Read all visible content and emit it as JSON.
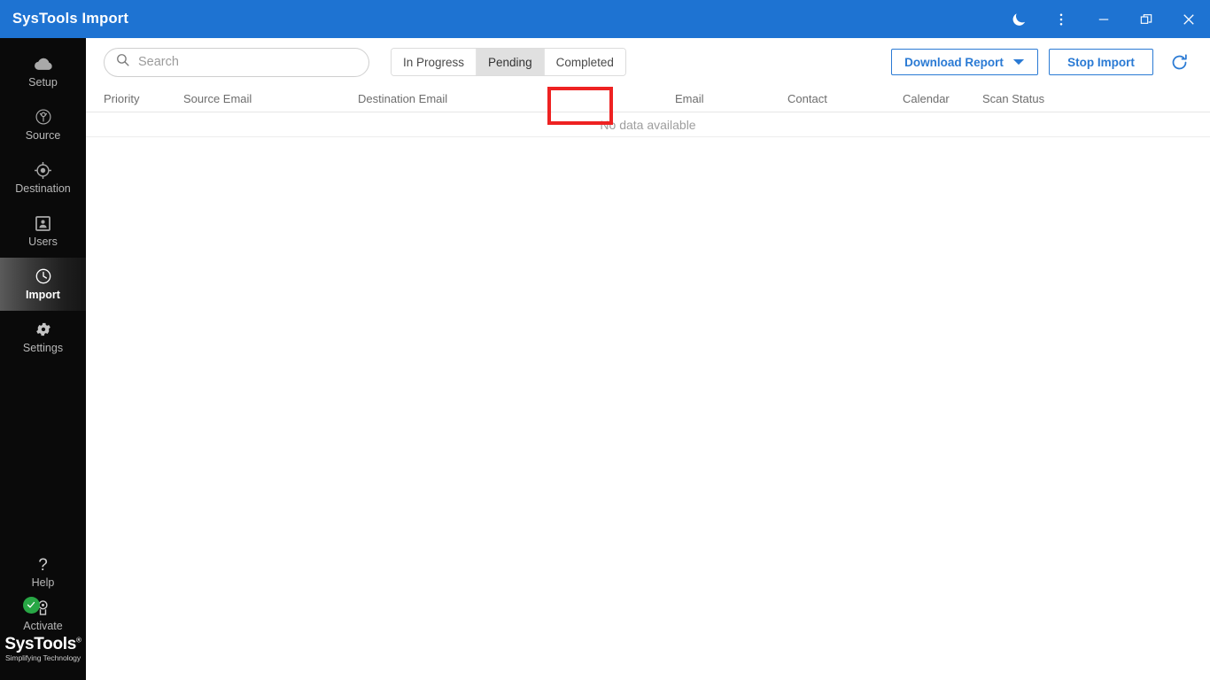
{
  "window": {
    "title": "SysTools Import",
    "controls": [
      {
        "name": "dark-mode-icon",
        "label": "Dark mode"
      },
      {
        "name": "more-menu-icon",
        "label": "More options"
      },
      {
        "name": "minimize-icon",
        "label": "Minimize"
      },
      {
        "name": "restore-icon",
        "label": "Restore"
      },
      {
        "name": "close-icon",
        "label": "Close"
      }
    ],
    "accent_color": "#1E73D2"
  },
  "sidebar": {
    "background": "#0a0a0a",
    "items": [
      {
        "label": "Setup",
        "icon": "cloud-icon",
        "active": false
      },
      {
        "label": "Source",
        "icon": "source-icon",
        "active": false
      },
      {
        "label": "Destination",
        "icon": "target-icon",
        "active": false
      },
      {
        "label": "Users",
        "icon": "contact-card-icon",
        "active": false
      },
      {
        "label": "Import",
        "icon": "clock-icon",
        "active": true
      },
      {
        "label": "Settings",
        "icon": "gear-icon",
        "active": false
      }
    ],
    "bottom_items": [
      {
        "label": "Help",
        "icon": "question-mark-icon"
      },
      {
        "label": "Activate",
        "icon": "award-icon",
        "badge": "check",
        "badge_color": "#28a745"
      }
    ],
    "logo": {
      "name": "SysTools",
      "registered": "®",
      "tagline": "Simplifying Technology"
    }
  },
  "toolbar": {
    "search": {
      "placeholder": "Search",
      "value": "",
      "icon": "search-icon"
    },
    "tabs": [
      {
        "label": "In Progress",
        "active": false
      },
      {
        "label": "Pending",
        "active": true
      },
      {
        "label": "Completed",
        "active": false
      }
    ],
    "download_report_label": "Download Report",
    "stop_import_label": "Stop Import",
    "refresh_icon": "refresh-icon",
    "button_color": "#2a7ad4"
  },
  "annotation": {
    "target": "Pending",
    "color": "#ee2222"
  },
  "table": {
    "columns": [
      "Priority",
      "Source Email",
      "Destination Email",
      "Email",
      "Contact",
      "Calendar",
      "Scan Status"
    ],
    "rows": [],
    "empty_message": "No data available"
  }
}
